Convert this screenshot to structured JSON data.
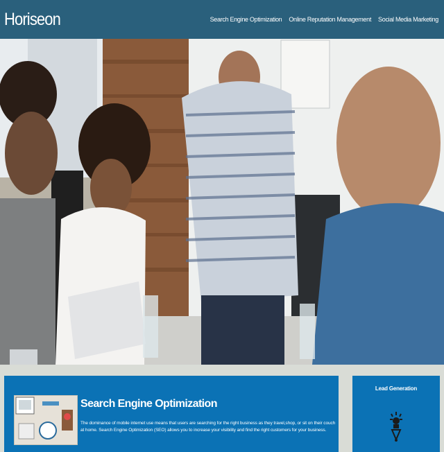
{
  "header": {
    "logo": "Horiseon",
    "nav": [
      {
        "label": "Search Engine Optimization"
      },
      {
        "label": "Online Reputation Management"
      },
      {
        "label": "Social Media Marketing"
      }
    ]
  },
  "hero": {
    "icon": "team-meeting-photo"
  },
  "main_card": {
    "title": "Search Engine Optimization",
    "text": "The dominance of mobile internet use means that users are searching for the right business as they travel,shop, or sit on their couch at home. Search Engine Optimization (SEO) allows you to increase your visibility and find the right customers for your business.",
    "image_icon": "seo-illustration-image"
  },
  "side_card": {
    "title": "Lead Generation",
    "icon": "lightbulb-icon"
  },
  "colors": {
    "header_bg": "#2a607c",
    "card_bg": "#0b72b5",
    "page_bg": "#d9dcd6",
    "text": "#ffffff"
  }
}
